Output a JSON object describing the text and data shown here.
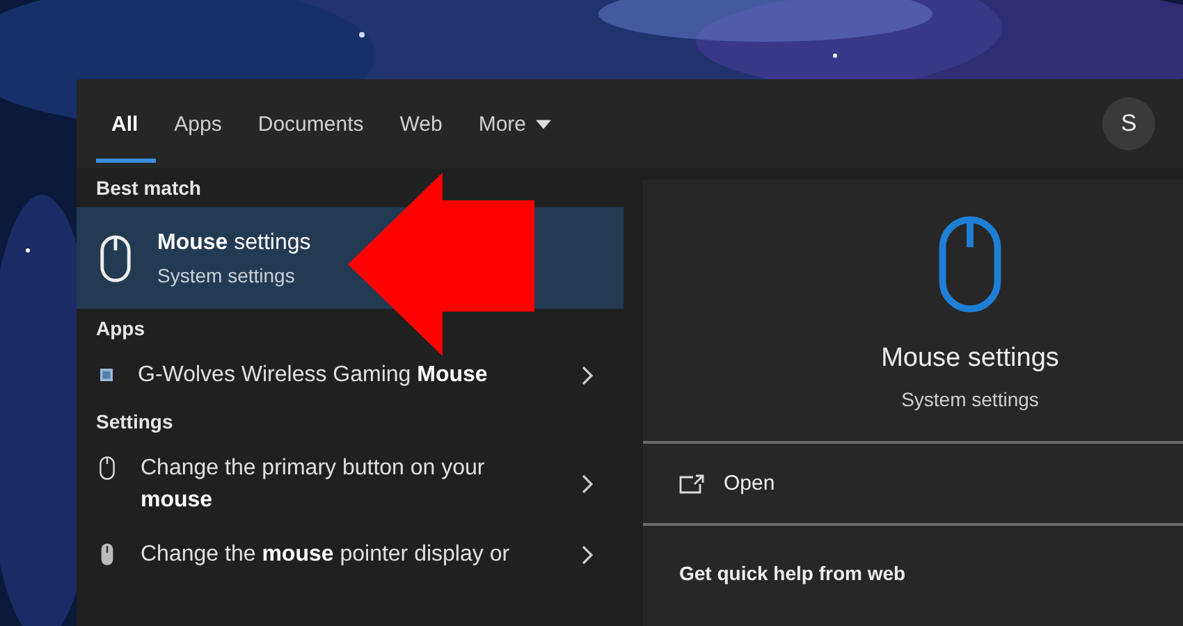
{
  "tabs": [
    {
      "label": "All",
      "selected": true
    },
    {
      "label": "Apps",
      "selected": false
    },
    {
      "label": "Documents",
      "selected": false
    },
    {
      "label": "Web",
      "selected": false
    },
    {
      "label": "More",
      "selected": false,
      "dropdown": true
    }
  ],
  "avatar": {
    "initial": "S"
  },
  "results": [
    {
      "kind": "heading",
      "text": "Best match"
    },
    {
      "kind": "best",
      "title": "**Mouse** settings",
      "subtitle": "System settings",
      "selected": true
    },
    {
      "kind": "heading",
      "text": "Apps"
    },
    {
      "kind": "app",
      "title": "G-Wolves Wireless Gaming **Mouse**",
      "selected": false
    },
    {
      "kind": "heading",
      "text": "Settings"
    },
    {
      "kind": "setting",
      "title": "Change the primary button on your **mouse**",
      "selected": false
    },
    {
      "kind": "pointer",
      "title": "Change the **mouse** pointer display or",
      "selected": false
    }
  ],
  "preview": {
    "title": "Mouse settings",
    "subtitle": "System settings",
    "actions": [
      "Open"
    ],
    "help_heading": "Get quick help from web"
  }
}
